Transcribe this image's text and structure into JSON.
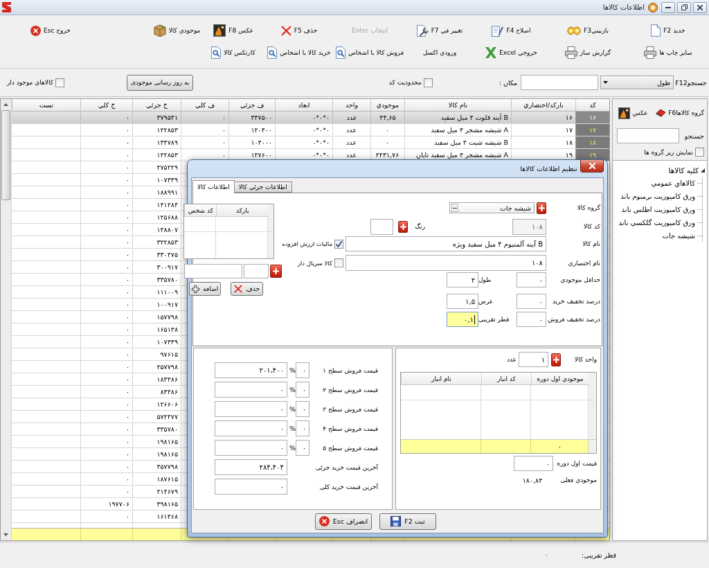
{
  "window": {
    "title": "اطلاعات کالاها"
  },
  "toolbar": {
    "rows": [
      [
        {
          "label": "جديد F2",
          "kind": "document",
          "disabled": false
        },
        {
          "label": "بازبينيF3",
          "kind": "glasses",
          "disabled": false
        },
        {
          "label": "اصلاح F4",
          "kind": "notepad",
          "disabled": false
        },
        {
          "label": "تغيير في F7",
          "kind": "tools",
          "disabled": false
        },
        {
          "label": "انتخاب Enter",
          "kind": "plain",
          "disabled": true
        },
        {
          "label": "حذف F5",
          "kind": "delete",
          "disabled": false
        },
        {
          "label": "عکس F8",
          "kind": "photo",
          "disabled": false
        },
        {
          "label": "موجودي کالا",
          "kind": "box",
          "disabled": false
        },
        {
          "label": "خروج Esc",
          "kind": "exit",
          "disabled": false
        }
      ],
      [
        {
          "label": "ساير چاپ ها",
          "kind": "printer",
          "disabled": false
        },
        {
          "label": "گزارش ساز",
          "kind": "printer",
          "disabled": false
        },
        {
          "label": "خروجي Excel",
          "kind": "excel",
          "disabled": false
        },
        {
          "label": "ورودي اکسل",
          "kind": "plain",
          "disabled": false
        },
        {
          "label": "فروش کالا با اشخاص",
          "kind": "report",
          "disabled": false
        },
        {
          "label": "خريد کالا با اشخاص",
          "kind": "report",
          "disabled": false
        },
        {
          "label": "کارتکس کالا",
          "kind": "report",
          "disabled": false
        }
      ]
    ]
  },
  "filter_bar": {
    "search_label": "جستجوF12",
    "search_field": {
      "value": "طول"
    },
    "location_label": "مکان :",
    "code_limit": {
      "label": "محدوديت کد",
      "checked": false
    },
    "update_button": "به روز رسانی موجودی",
    "in_stock_only": {
      "label": "کالاهاي موجود دار",
      "checked": false
    }
  },
  "table": {
    "columns": [
      "کد",
      "بارکد/اختصاري",
      "نام کالا",
      "موجودي",
      "واحد",
      "ابعاد",
      "ف جزئي",
      "ف کلي",
      "خ جزئي",
      "خ کلي",
      "تست"
    ],
    "rows": [
      {
        "selected": true,
        "code": "۱۶",
        "barcode": "۱۶",
        "name": "B آينه فلوت ۴ ميل سفيد",
        "stock": "۴۴,۶۵",
        "unit": "عدد",
        "dimensions": "۰*۰*۰",
        "retail_sale": "۳۴۷۵۰۰",
        "wholesale_sale": "۰",
        "retail_buy": "۳۷۹۵۴۱",
        "wholesale_buy": "۰"
      },
      {
        "selected": false,
        "code": "۱۷",
        "barcode": "۱۷",
        "name": "A شيشه مشجر ۴ ميل سفيد",
        "stock": "۰",
        "unit": "عدد",
        "dimensions": "۰*۰*۰",
        "retail_sale": "۱۲۰۴۰۰",
        "wholesale_sale": "۰",
        "retail_buy": "۱۲۲۸۵۳",
        "wholesale_buy": "۰"
      },
      {
        "selected": false,
        "code": "۱۸",
        "barcode": "۱۸",
        "name": "B شيشه شيت ۴ ميل سفيد",
        "stock": "۰",
        "unit": "عدد",
        "dimensions": "۰*۰*۰",
        "retail_sale": "۱۰۴۰۰۰",
        "wholesale_sale": "۰",
        "retail_buy": "۱۳۴۷۸۹",
        "wholesale_buy": "۰"
      },
      {
        "selected": false,
        "code": "۱۹",
        "barcode": "۱۹",
        "name": "A شيشه مشجر ۴ ميل سفيد تاپان",
        "stock": "۲۲۳۱,۷۶",
        "unit": "عدد",
        "dimensions": "۰*۰*۰",
        "retail_sale": "۱۲۷۶۰۰",
        "wholesale_sale": "۰",
        "retail_buy": "۱۲۲۸۵۳",
        "wholesale_buy": "۰"
      },
      {
        "selected": false,
        "retail_buy": "۲۷۵۲۲۹",
        "wholesale_buy": "۰"
      },
      {
        "selected": false,
        "retail_buy": "۱۰۷۳۳۹",
        "wholesale_buy": "۰"
      },
      {
        "selected": false,
        "retail_buy": "۱۸۸۹۹۱",
        "wholesale_buy": "۰"
      },
      {
        "selected": false,
        "retail_buy": "۱۴۱۲۸۴",
        "wholesale_buy": "۰"
      },
      {
        "selected": false,
        "retail_buy": "۱۲۵۶۸۸",
        "wholesale_buy": "۰"
      },
      {
        "selected": false,
        "retail_buy": "۱۲۸۸۰۷",
        "wholesale_buy": "۰"
      },
      {
        "selected": false,
        "retail_buy": "۳۲۲۸۵۳",
        "wholesale_buy": "۰"
      },
      {
        "selected": false,
        "retail_buy": "۳۳۰۲۷۵",
        "wholesale_buy": "۰"
      },
      {
        "selected": false,
        "retail_buy": "۳۰۰۹۱۷",
        "wholesale_buy": "۰"
      },
      {
        "selected": false,
        "retail_buy": "۳۳۵۷۸۰",
        "wholesale_buy": "۰"
      },
      {
        "selected": false,
        "retail_buy": "۱۱۱۰۰۹",
        "wholesale_buy": "۰"
      },
      {
        "selected": false,
        "retail_buy": "۱۰۰۹۱۷",
        "wholesale_buy": "۰"
      },
      {
        "selected": false,
        "retail_buy": "۱۵۷۷۹۸",
        "wholesale_buy": "۰"
      },
      {
        "selected": false,
        "retail_buy": "۱۶۵۱۳۸",
        "wholesale_buy": "۰"
      },
      {
        "selected": false,
        "retail_buy": "۱۰۷۳۳۹",
        "wholesale_buy": "۰"
      },
      {
        "selected": false,
        "retail_buy": "۹۷۶۱۵",
        "wholesale_buy": "۰"
      },
      {
        "selected": false,
        "retail_buy": "۲۵۷۷۹۸",
        "wholesale_buy": "۰"
      },
      {
        "selected": false,
        "retail_buy": "۱۸۳۴۸۶",
        "wholesale_buy": "۰"
      },
      {
        "selected": false,
        "retail_buy": "۸۳۴۸۶",
        "wholesale_buy": "۰"
      },
      {
        "selected": false,
        "retail_buy": "۱۲۶۶۰۶",
        "wholesale_buy": "۰"
      },
      {
        "selected": false,
        "retail_buy": "۵۷۲۴۷۷",
        "wholesale_buy": "۰"
      },
      {
        "selected": false,
        "retail_buy": "۳۳۵۷۸۰",
        "wholesale_buy": "۰"
      },
      {
        "selected": false,
        "retail_buy": "۱۹۸۱۶۵",
        "wholesale_buy": "۰"
      },
      {
        "selected": false,
        "retail_buy": "۱۹۸۱۶۵",
        "wholesale_buy": "۰"
      },
      {
        "selected": false,
        "retail_buy": "۴۵۷۷۹۸",
        "wholesale_buy": "۰"
      },
      {
        "selected": false,
        "retail_buy": "۱۸۷۶۱۵",
        "wholesale_buy": "۰"
      },
      {
        "selected": false,
        "retail_buy": "۲۱۴۶۷۹",
        "wholesale_buy": "۰"
      },
      {
        "selected": false,
        "retail_buy": "۳۹۸۱۶۵",
        "wholesale_buy": "۱۹۷۷۰۶"
      },
      {
        "selected": false,
        "retail_buy": "۱۶۱۴۶۸",
        "wholesale_buy": "۰"
      }
    ]
  },
  "sidebar": {
    "group_button": "گروه کالاهاF6",
    "photo_button": "عکس",
    "search_label": "جستجو",
    "show_subgroups": {
      "label": "نمايش زير گروه ها",
      "checked": false
    },
    "tree": [
      {
        "label": "کليه کالاها",
        "expanded": true,
        "children": [
          {
            "label": "کالاهاي عمومي"
          },
          {
            "label": "ورق کامپوزيت برمبوم باند"
          },
          {
            "label": "ورق کامپوزيت اطلس باند"
          },
          {
            "label": "ورق کامپوزيت گلکسي باند"
          },
          {
            "label": "شيشه جات"
          }
        ]
      }
    ]
  },
  "dialog": {
    "title": "تنظيم اطلاعات کالاها",
    "tabs": [
      {
        "label": "اطلاعات جزئي کالا",
        "selected": false
      },
      {
        "label": "اطلاعات کالا",
        "selected": true
      }
    ],
    "group": {
      "label": "گروه کالا",
      "value": "شيشه جات"
    },
    "code": {
      "label": "کد کالا",
      "value": "۱۰۸",
      "disabled": true
    },
    "color": {
      "label": "رنگ"
    },
    "name": {
      "label": "نام کالا",
      "value": "B آينه آلمنيوم ۴ ميل سفيد ويژه"
    },
    "vat": {
      "label": "ماليات ارزش افزوده",
      "checked": true
    },
    "short_name": {
      "label": "نام اختصاري",
      "value": "۱۰۸"
    },
    "serial": {
      "label": "کالا سريال دار",
      "checked": false
    },
    "min_stock": {
      "label": "حداقل موجودي",
      "value": "۰"
    },
    "length": {
      "label": "طول",
      "value": "۲"
    },
    "buy_discount": {
      "label": "درصد تخفيف خريد",
      "value": "۰"
    },
    "width": {
      "label": "عرض",
      "value": "۱,۵"
    },
    "sale_discount": {
      "label": "درصد تخفيف فروش",
      "value": "۰"
    },
    "diameter": {
      "label": "قطر تقريبی",
      "value": "۰,۱",
      "focused": true
    },
    "barcodes": {
      "columns": [
        "بارکد",
        "کد شخص"
      ],
      "delete_button": "حذف",
      "add_button": "اضافه"
    },
    "unit": {
      "label": "واحد کالا",
      "value": "۱",
      "name": "عدد"
    },
    "warehouses": {
      "columns": [
        "موجودي اول دوره",
        "کد انبار",
        "نام انبار"
      ],
      "total": "۰"
    },
    "opening_price": {
      "label": "قيمت اول دوره",
      "value": "۰"
    },
    "current_stock": {
      "label": "موجودي فعلی",
      "value": "۱۸۰,۸۴"
    },
    "price_levels": [
      {
        "label": "قيمت فروش سطح ۱",
        "percent": "۰",
        "percent_sign": "%",
        "value": "۲۰۱،۴۰۰"
      },
      {
        "label": "قيمت فروش سطح ۲",
        "percent": "۰",
        "percent_sign": "%",
        "value": "۰"
      },
      {
        "label": "قيمت فروش سطح ۳",
        "percent": "۰",
        "percent_sign": "%",
        "value": "۰"
      },
      {
        "label": "قيمت فروش سطح ۴",
        "percent": "۰",
        "percent_sign": "%",
        "value": "۰"
      },
      {
        "label": "قيمت فروش سطح ۵",
        "percent": "۰",
        "percent_sign": "%",
        "value": "۰"
      }
    ],
    "last_retail_buy": {
      "label": "آخرين قيمت خريد جزئی",
      "value": "۲۸۴،۴۰۴"
    },
    "last_wholesale_buy": {
      "label": "آخرين قيمت خريد کلی",
      "value": "۰"
    },
    "buttons": [
      {
        "label": "ثبت F2",
        "kind": "save"
      },
      {
        "label": "انصراف Esc",
        "kind": "cancel"
      }
    ]
  },
  "status_bar": {
    "label": "قطر تقريبی:",
    "value": "۰"
  }
}
